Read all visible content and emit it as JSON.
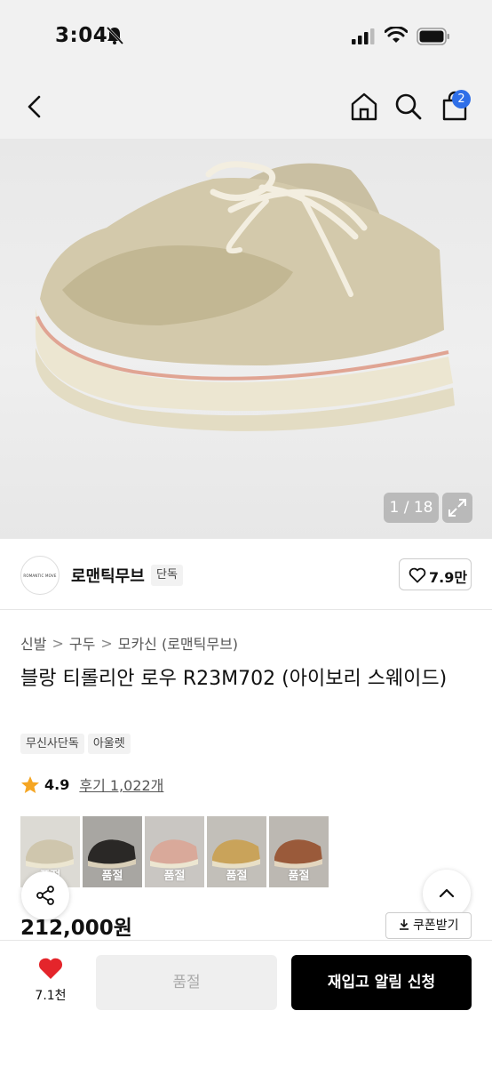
{
  "status_bar": {
    "time": "3:04"
  },
  "nav": {
    "cart_count": "2"
  },
  "gallery": {
    "counter": "1 / 18"
  },
  "brand": {
    "logo_text": "ROMANTIC MOVE",
    "name": "로맨틱무브",
    "tag": "단독",
    "likes": "7.9만"
  },
  "breadcrumb": {
    "items": [
      "신발",
      "구두",
      "모카신 (로맨틱무브)"
    ],
    "separator": ">"
  },
  "product": {
    "title": "블랑 티롤리안 로우 R23M702 (아이보리 스웨이드)",
    "tags": [
      "무신사단독",
      "아울렛"
    ],
    "rating": "4.9",
    "review_text": "후기 1,022개",
    "price": "212,000원"
  },
  "colors": {
    "options": [
      {
        "name": "ivory",
        "color": "#cfc6ad",
        "soldout": "품절"
      },
      {
        "name": "black",
        "color": "#2a2826",
        "soldout": "품절"
      },
      {
        "name": "pink",
        "color": "#d9a99a",
        "soldout": "품절"
      },
      {
        "name": "mustard",
        "color": "#c9a35a",
        "soldout": "품절"
      },
      {
        "name": "brown",
        "color": "#9a5a3a",
        "soldout": "품절"
      }
    ]
  },
  "actions": {
    "coupon": "쿠폰받기",
    "wish_count": "7.1천",
    "soldout_label": "품절",
    "restock_label": "재입고 알림 신청"
  },
  "theme": {
    "accent": "#2f6fe8",
    "heart": "#e4252b",
    "star": "#f5a623"
  }
}
